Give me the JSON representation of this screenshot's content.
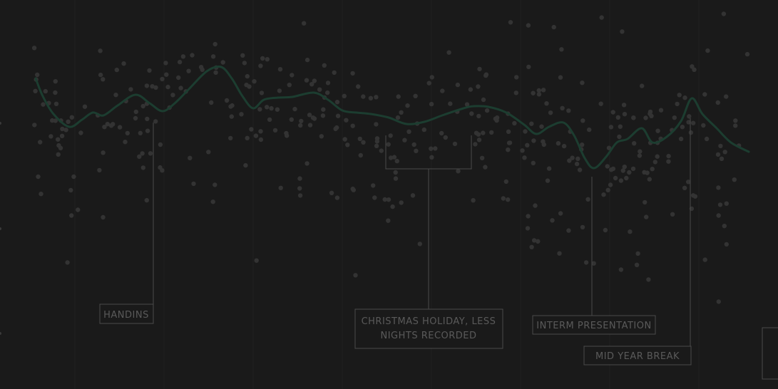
{
  "chart_data": {
    "type": "scatter",
    "grid": true,
    "annotations": [
      {
        "lines": [
          "HANDINS"
        ]
      },
      {
        "lines": [
          "CHRISTMAS HOLIDAY, LESS",
          "NIGHTS RECORDED"
        ]
      },
      {
        "lines": [
          "INTERM PRESENTATION"
        ]
      },
      {
        "lines": [
          "MID YEAR BREAK"
        ]
      }
    ],
    "colors": {
      "background": "#1a1a1a",
      "points": "#333333",
      "trend": "#1c3d30",
      "annotation": "#4a4a4a"
    }
  }
}
